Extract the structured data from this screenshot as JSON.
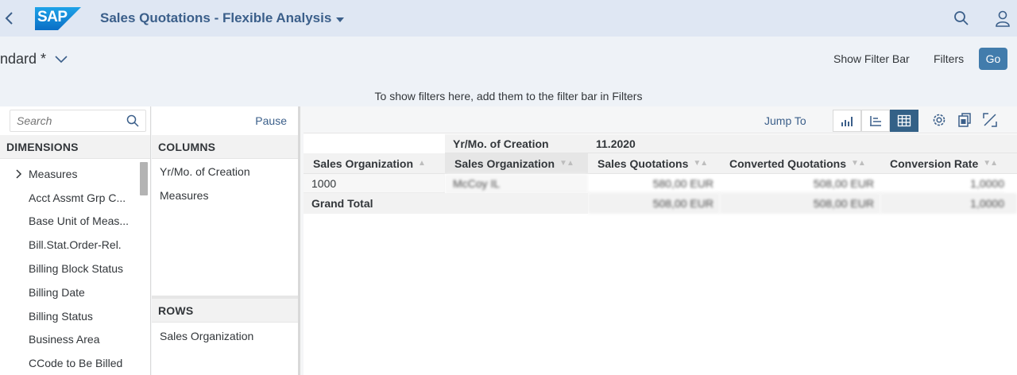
{
  "shell": {
    "app_title": "Sales Quotations - Flexible Analysis",
    "logo_text": "SAP"
  },
  "header": {
    "variant_name": "ndard *",
    "show_filter_bar": "Show Filter Bar",
    "filters": "Filters",
    "go": "Go",
    "filter_hint": "To show filters here, add them to the filter bar in Filters"
  },
  "dimensions_panel": {
    "search_placeholder": "Search",
    "heading": "DIMENSIONS",
    "items": [
      "Measures",
      "Acct Assmt Grp C...",
      "Base Unit of Meas...",
      "Bill.Stat.Order-Rel.",
      "Billing Block Status",
      "Billing Date",
      "Billing Status",
      "Business Area",
      "CCode to Be Billed"
    ]
  },
  "layout_panel": {
    "pause": "Pause",
    "columns_heading": "COLUMNS",
    "columns": [
      "Yr/Mo. of Creation",
      "Measures"
    ],
    "rows_heading": "ROWS",
    "rows": [
      "Sales Organization"
    ]
  },
  "toolbar": {
    "jump_to": "Jump To"
  },
  "pivot": {
    "top_header_label": "Yr/Mo. of Creation",
    "top_header_value": "11.2020",
    "columns": [
      "Sales Organization",
      "Sales Organization",
      "Sales Quotations",
      "Converted Quotations",
      "Conversion Rate"
    ],
    "rows": [
      [
        "1000",
        "McCoy IL",
        "580,00 EUR",
        "508,00 EUR",
        "1,0000"
      ],
      [
        "Grand Total",
        "",
        "508,00 EUR",
        "508,00 EUR",
        "1,0000"
      ]
    ]
  },
  "colors": {
    "shell_bg": "#dfe7f3",
    "accent": "#427cac",
    "title_blue": "#3b5f8a",
    "active_segment": "#346187"
  }
}
